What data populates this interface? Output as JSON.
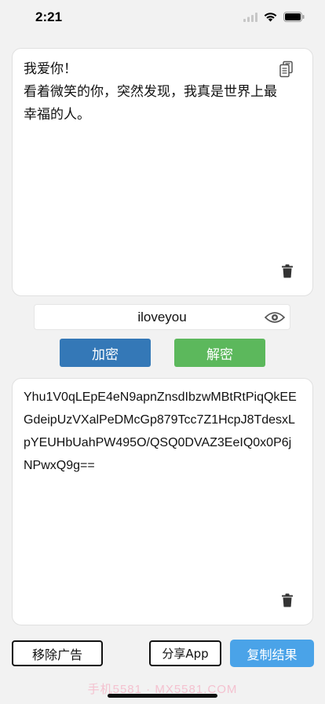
{
  "status_bar": {
    "time": "2:21",
    "icons": [
      "signal-icon",
      "wifi-icon",
      "battery-icon"
    ]
  },
  "input_card": {
    "text": "我爱你！\n看着微笑的你，突然发现，我真是世界上最幸福的人。",
    "icons": [
      "copy-document-icon",
      "trash-icon"
    ]
  },
  "key_field": {
    "value": "iloveyou",
    "icon": "eye-icon"
  },
  "actions": {
    "encrypt_label": "加密",
    "decrypt_label": "解密"
  },
  "output_card": {
    "text": "Yhu1V0qLEpE4eN9apnZnsdIbzwMBtRtPiqQkEEGdeipUzVXalPeDMcGp879Tcc7Z1HcpJ8TdesxLpYEUHbUahPW495O/QSQ0DVAZ3EeIQ0x0P6jNPwxQ9g==",
    "icons": [
      "trash-icon"
    ]
  },
  "bottom_bar": {
    "remove_ads_label": "移除广告",
    "share_label": "分享App",
    "copy_result_label": "复制结果"
  },
  "watermark": "手机5581 · MX5581.COM",
  "colors": {
    "encrypt": "#3478b7",
    "decrypt": "#5cb85c",
    "copy_result": "#4aa3e8"
  }
}
